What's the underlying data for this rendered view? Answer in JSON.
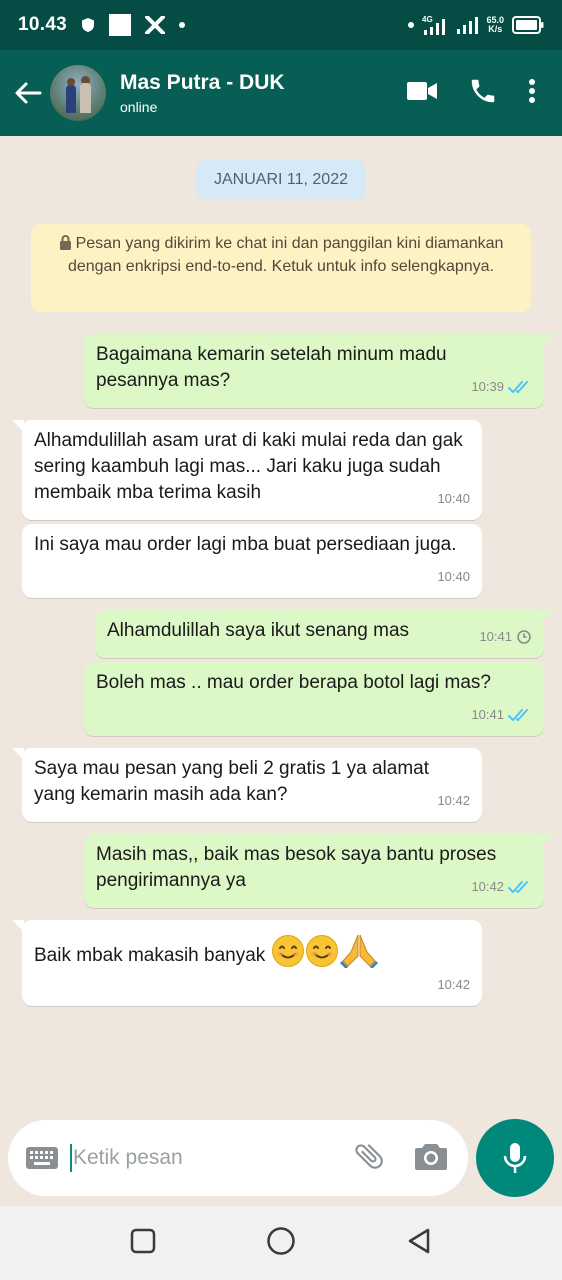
{
  "status_bar": {
    "time": "10.43",
    "network_label": "4G",
    "speed_value": "65.0",
    "speed_unit": "K/s"
  },
  "app_bar": {
    "contact_name": "Mas Putra - DUK",
    "presence": "online",
    "icons": [
      "back-arrow-icon",
      "video-call-icon",
      "phone-icon",
      "more-vert-icon"
    ]
  },
  "chat": {
    "date_chip": "JANUARI 11, 2022",
    "encryption_notice": "Pesan yang dikirim ke chat ini dan panggilan kini diamankan dengan enkripsi end-to-end. Ketuk untuk info selengkapnya.",
    "messages": [
      {
        "dir": "out",
        "text": "Bagaimana kemarin setelah minum madu pesannya mas?",
        "time": "10:39",
        "status": "read"
      },
      {
        "dir": "in",
        "text": "Alhamdulillah asam urat di kaki mulai reda dan gak sering kaambuh lagi mas... Jari kaku juga sudah membaik mba terima kasih",
        "time": "10:40"
      },
      {
        "dir": "in",
        "text": "Ini saya mau order lagi mba buat persediaan juga.",
        "time": "10:40"
      },
      {
        "dir": "out",
        "text": "Alhamdulillah saya ikut senang mas",
        "time": "10:41",
        "status": "pending"
      },
      {
        "dir": "out",
        "text": "Boleh mas .. mau order berapa botol lagi mas?",
        "time": "10:41",
        "status": "read"
      },
      {
        "dir": "in",
        "text": "Saya mau pesan yang beli 2 gratis 1 ya alamat yang kemarin masih ada kan?",
        "time": "10:42"
      },
      {
        "dir": "out",
        "text": "Masih mas,, baik mas besok saya bantu proses pengirimannya ya",
        "time": "10:42",
        "status": "read"
      },
      {
        "dir": "in",
        "text": "Baik mbak makasih banyak",
        "time": "10:42",
        "emojis": [
          "smiling-face-icon",
          "smiling-face-icon",
          "folded-hands-icon"
        ]
      }
    ]
  },
  "composer": {
    "placeholder": "Ketik pesan"
  },
  "colors": {
    "header": "#075e54",
    "status_bar": "#054d44",
    "outgoing_bubble": "#dcf8c6",
    "incoming_bubble": "#ffffff",
    "read_tick": "#4fc3f7",
    "mic_button": "#00897b",
    "chat_background": "#efe7de"
  }
}
